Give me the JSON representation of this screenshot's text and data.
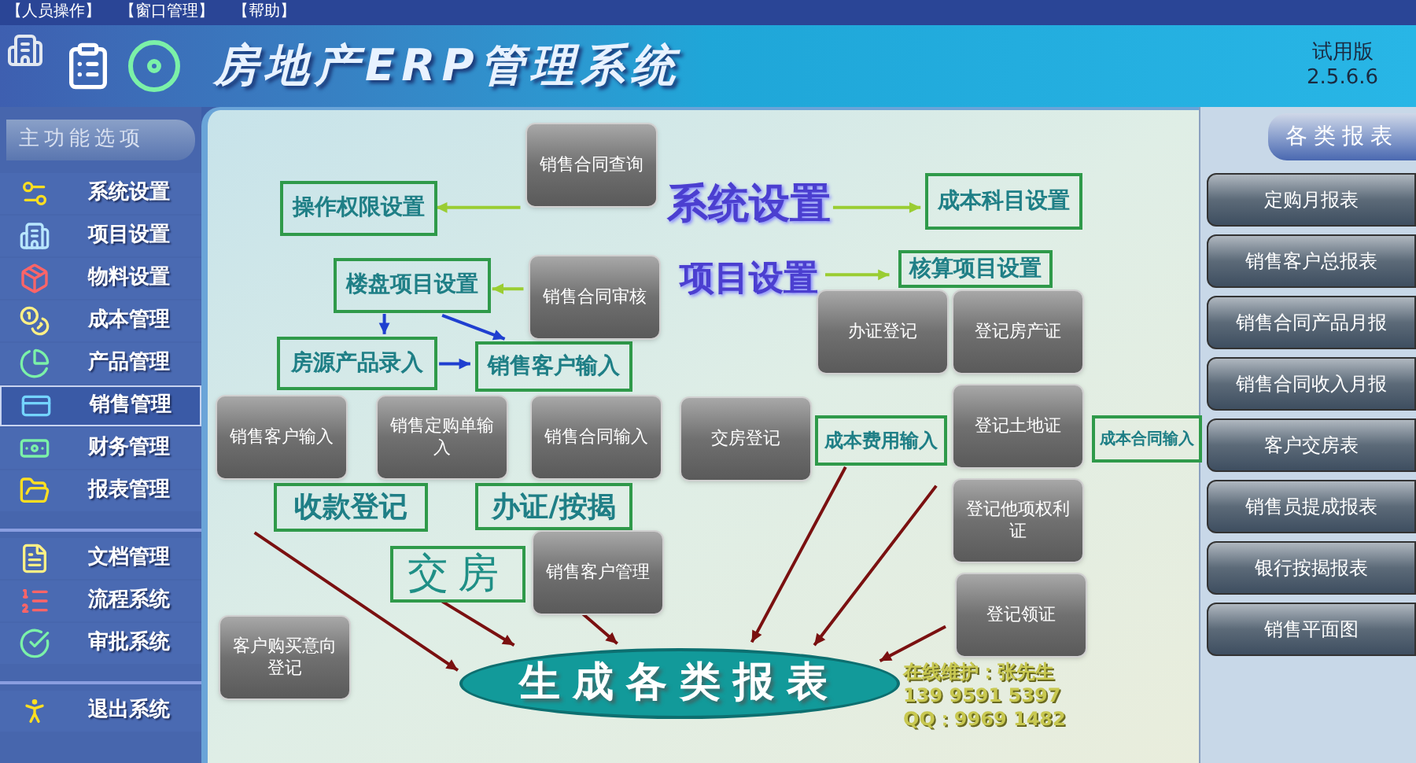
{
  "menu_bar": [
    "【人员操作】",
    "【窗口管理】",
    "【帮助】"
  ],
  "header": {
    "title": "房地产ERP管理系统",
    "edition": "试用版",
    "version": "2.5.6.6"
  },
  "sidebar": {
    "title": "主功能选项",
    "groups": [
      {
        "items": [
          {
            "label": "系统设置",
            "selected": false
          },
          {
            "label": "项目设置",
            "selected": false
          },
          {
            "label": "物料设置",
            "selected": false
          },
          {
            "label": "成本管理",
            "selected": false
          },
          {
            "label": "产品管理",
            "selected": false
          },
          {
            "label": "销售管理",
            "selected": true
          },
          {
            "label": "财务管理",
            "selected": false
          },
          {
            "label": "报表管理",
            "selected": false
          }
        ]
      },
      {
        "items": [
          {
            "label": "文档管理",
            "selected": false
          },
          {
            "label": "流程系统",
            "selected": false
          },
          {
            "label": "审批系统",
            "selected": false
          }
        ]
      },
      {
        "items": [
          {
            "label": "退出系统",
            "selected": false
          }
        ]
      }
    ]
  },
  "diagram": {
    "nodes": [
      {
        "label": "操作权限设置",
        "kind": "box"
      },
      {
        "label": "系统设置",
        "kind": "heading"
      },
      {
        "label": "成本科目设置",
        "kind": "box"
      },
      {
        "label": "楼盘项目设置",
        "kind": "box"
      },
      {
        "label": "项目设置",
        "kind": "heading"
      },
      {
        "label": "核算项目设置",
        "kind": "box"
      },
      {
        "label": "房源产品录入",
        "kind": "box"
      },
      {
        "label": "销售客户输入",
        "kind": "box"
      },
      {
        "label": "成本费用输入",
        "kind": "box"
      },
      {
        "label": "成本合同输入",
        "kind": "box"
      },
      {
        "label": "收款登记",
        "kind": "box"
      },
      {
        "label": "办证/按揭",
        "kind": "box"
      },
      {
        "label": "交房",
        "kind": "large"
      },
      {
        "label": "生成各类报表",
        "kind": "ellipse"
      }
    ],
    "contact": [
      "在线维护：张先生",
      "139 9591 5397",
      "QQ：9969 1482"
    ]
  },
  "action_buttons": [
    "销售合同查询",
    "销售合同审核",
    "办证登记",
    "登记房产证",
    "销售客户输入",
    "销售定购单输入",
    "销售合同输入",
    "交房登记",
    "登记土地证",
    "登记他项权利证",
    "销售客户管理",
    "登记领证",
    "客户购买意向登记"
  ],
  "reports": {
    "title": "各类报表",
    "items": [
      "定购月报表",
      "销售客户总报表",
      "销售合同产品月报",
      "销售合同收入月报",
      "客户交房表",
      "销售员提成报表",
      "银行按揭报表",
      "销售平面图"
    ]
  }
}
